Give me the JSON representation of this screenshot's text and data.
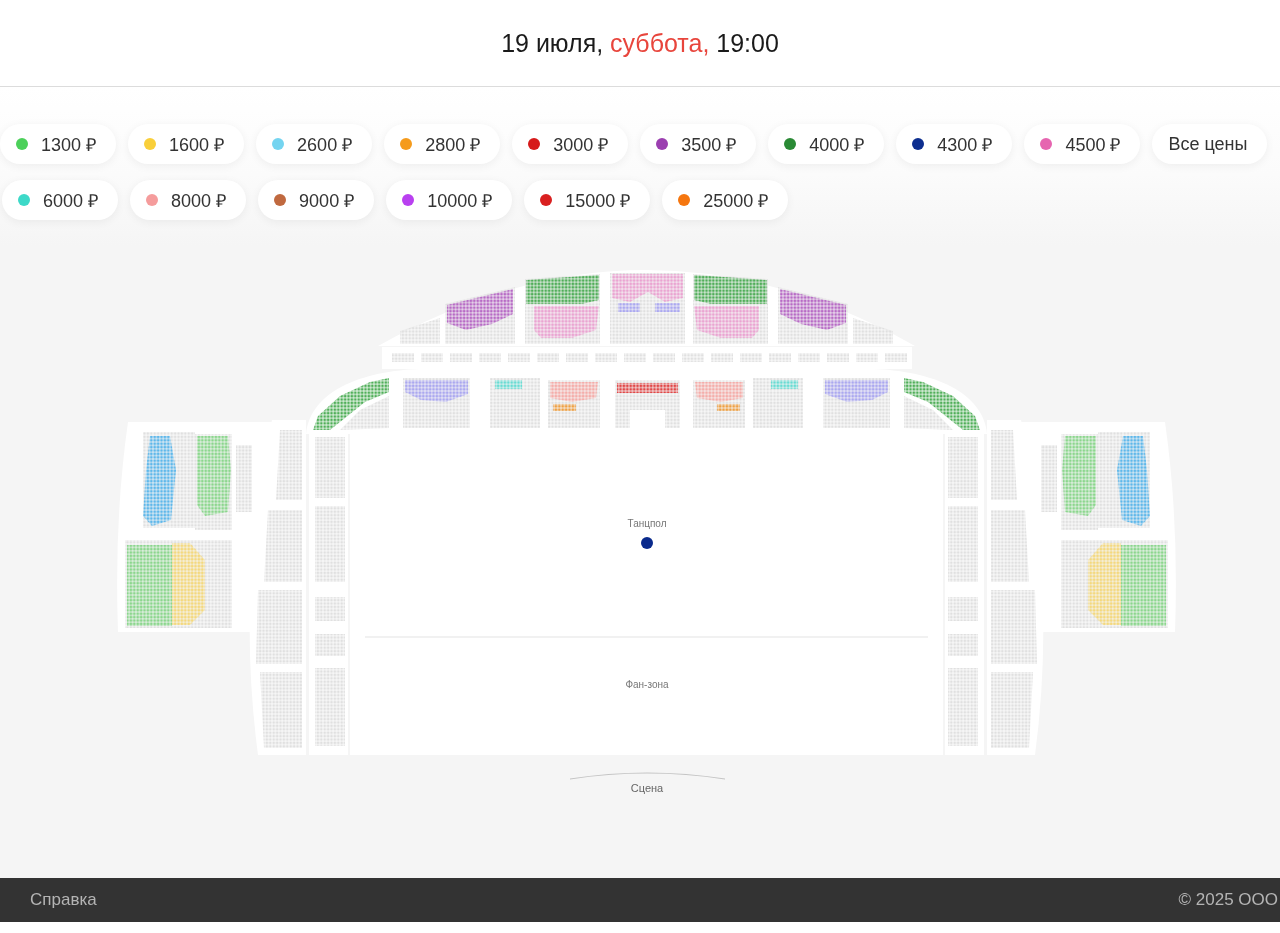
{
  "header": {
    "date": "19 июля,",
    "weekday": "суббота,",
    "time": "19:00"
  },
  "price_filters": [
    {
      "chips": [
        {
          "kind": "price",
          "label": "1300 ₽",
          "color": "#4cd05a",
          "selected": false
        },
        {
          "kind": "price",
          "label": "1600 ₽",
          "color": "#f9cf3a",
          "selected": false
        },
        {
          "kind": "price",
          "label": "2600 ₽",
          "color": "#74d4f0",
          "selected": false
        },
        {
          "kind": "price",
          "label": "2800 ₽",
          "color": "#f59b1c",
          "selected": false
        },
        {
          "kind": "price",
          "label": "3000 ₽",
          "color": "#d61a1a",
          "selected": false
        },
        {
          "kind": "price",
          "label": "3500 ₽",
          "color": "#9b3fb0",
          "selected": false
        },
        {
          "kind": "price",
          "label": "4000 ₽",
          "color": "#2a8a35",
          "selected": false
        },
        {
          "kind": "price",
          "label": "4300 ₽",
          "color": "#0d2e8f",
          "selected": false
        },
        {
          "kind": "price",
          "label": "4500 ₽",
          "color": "#e665b0",
          "selected": false
        },
        {
          "kind": "all",
          "label": "Все цены",
          "selected": false
        }
      ]
    },
    {
      "chips": [
        {
          "kind": "price",
          "label": "6000 ₽",
          "color": "#3dd9c8",
          "selected": false
        },
        {
          "kind": "price",
          "label": "8000 ₽",
          "color": "#f59c9c",
          "selected": false
        },
        {
          "kind": "price",
          "label": "9000 ₽",
          "color": "#c0693f",
          "selected": false
        },
        {
          "kind": "price",
          "label": "10000 ₽",
          "color": "#b940f0",
          "selected": false
        },
        {
          "kind": "price",
          "label": "15000 ₽",
          "color": "#d92020",
          "selected": false
        },
        {
          "kind": "price",
          "label": "25000 ₽",
          "color": "#f5760f",
          "selected": false
        }
      ]
    }
  ],
  "map": {
    "zones": [
      {
        "label": "Танцпол",
        "color": "#0a2a8c"
      },
      {
        "label": "Фан-зона"
      }
    ],
    "stage": "Сцена"
  },
  "footer": {
    "help_link": "Справка",
    "copyright": "© 2025 ООО"
  }
}
